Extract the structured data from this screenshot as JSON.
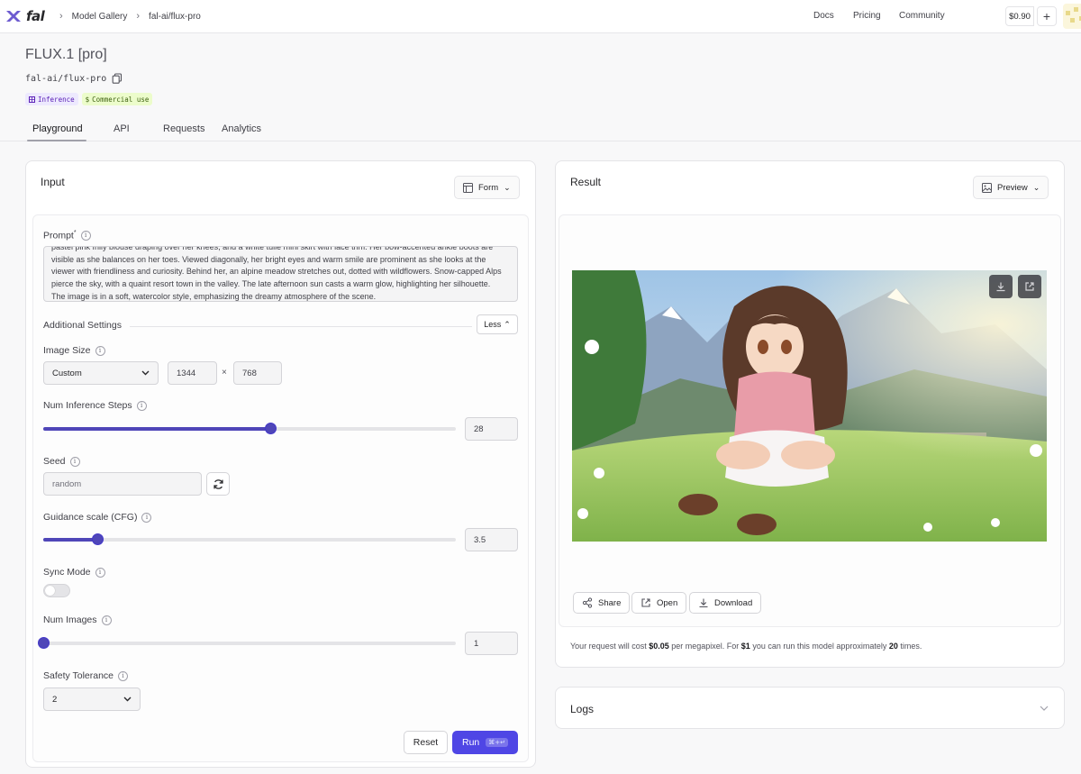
{
  "nav": {
    "logo_text": "fal",
    "breadcrumb": [
      "Model Gallery",
      "fal-ai/flux-pro"
    ],
    "links": [
      "Docs",
      "Pricing",
      "Community"
    ],
    "credit": "$0.90",
    "add_label": "+"
  },
  "header": {
    "title": "FLUX.1 [pro]",
    "model_id": "fal-ai/flux-pro",
    "tags": [
      "Inference",
      "Commercial use"
    ],
    "tabs": [
      "Playground",
      "API",
      "Requests",
      "Analytics"
    ],
    "active_tab": "Playground"
  },
  "input": {
    "title": "Input",
    "mode": "Form",
    "prompt_label": "Prompt",
    "prompt_required": "*",
    "prompt_value": "pastel pink frilly blouse draping over her knees, and a white tulle mini skirt with lace trim. Her bow-accented ankle boots are visible as she balances on her toes. Viewed diagonally, her bright eyes and warm smile are prominent as she looks at the viewer with friendliness and curiosity. Behind her, an alpine meadow stretches out, dotted with wildflowers. Snow-capped Alps pierce the sky, with a quaint resort town in the valley. The late afternoon sun casts a warm glow, highlighting her silhouette. The image is in a soft, watercolor style, emphasizing the dreamy atmosphere of the scene.",
    "additional_settings": "Additional Settings",
    "less_label": "Less",
    "image_size": {
      "label": "Image Size",
      "preset": "Custom",
      "width": "1344",
      "height": "768",
      "separator": "×"
    },
    "steps": {
      "label": "Num Inference Steps",
      "value": "28",
      "min": 1,
      "max": 50
    },
    "seed": {
      "label": "Seed",
      "placeholder": "random"
    },
    "guidance": {
      "label": "Guidance scale (CFG)",
      "value": "3.5",
      "min": 1,
      "max": 20
    },
    "sync_mode": {
      "label": "Sync Mode",
      "on": false
    },
    "num_images": {
      "label": "Num Images",
      "value": "1",
      "min": 1,
      "max": 4
    },
    "safety": {
      "label": "Safety Tolerance",
      "value": "2"
    },
    "reset_label": "Reset",
    "run_label": "Run",
    "run_shortcut": "⌘+↵"
  },
  "result": {
    "title": "Result",
    "view": "Preview",
    "actions": [
      "Share",
      "Open",
      "Download"
    ],
    "cost": {
      "prefix": "Your request will cost ",
      "price": "$0.05",
      "mid": " per megapixel. For ",
      "budget": "$1",
      "mid2": " you can run this model approximately ",
      "count": "20",
      "suffix": " times."
    }
  },
  "logs": {
    "title": "Logs"
  },
  "colors": {
    "accent": "#4f46e5",
    "slider": "#4f46b8"
  }
}
